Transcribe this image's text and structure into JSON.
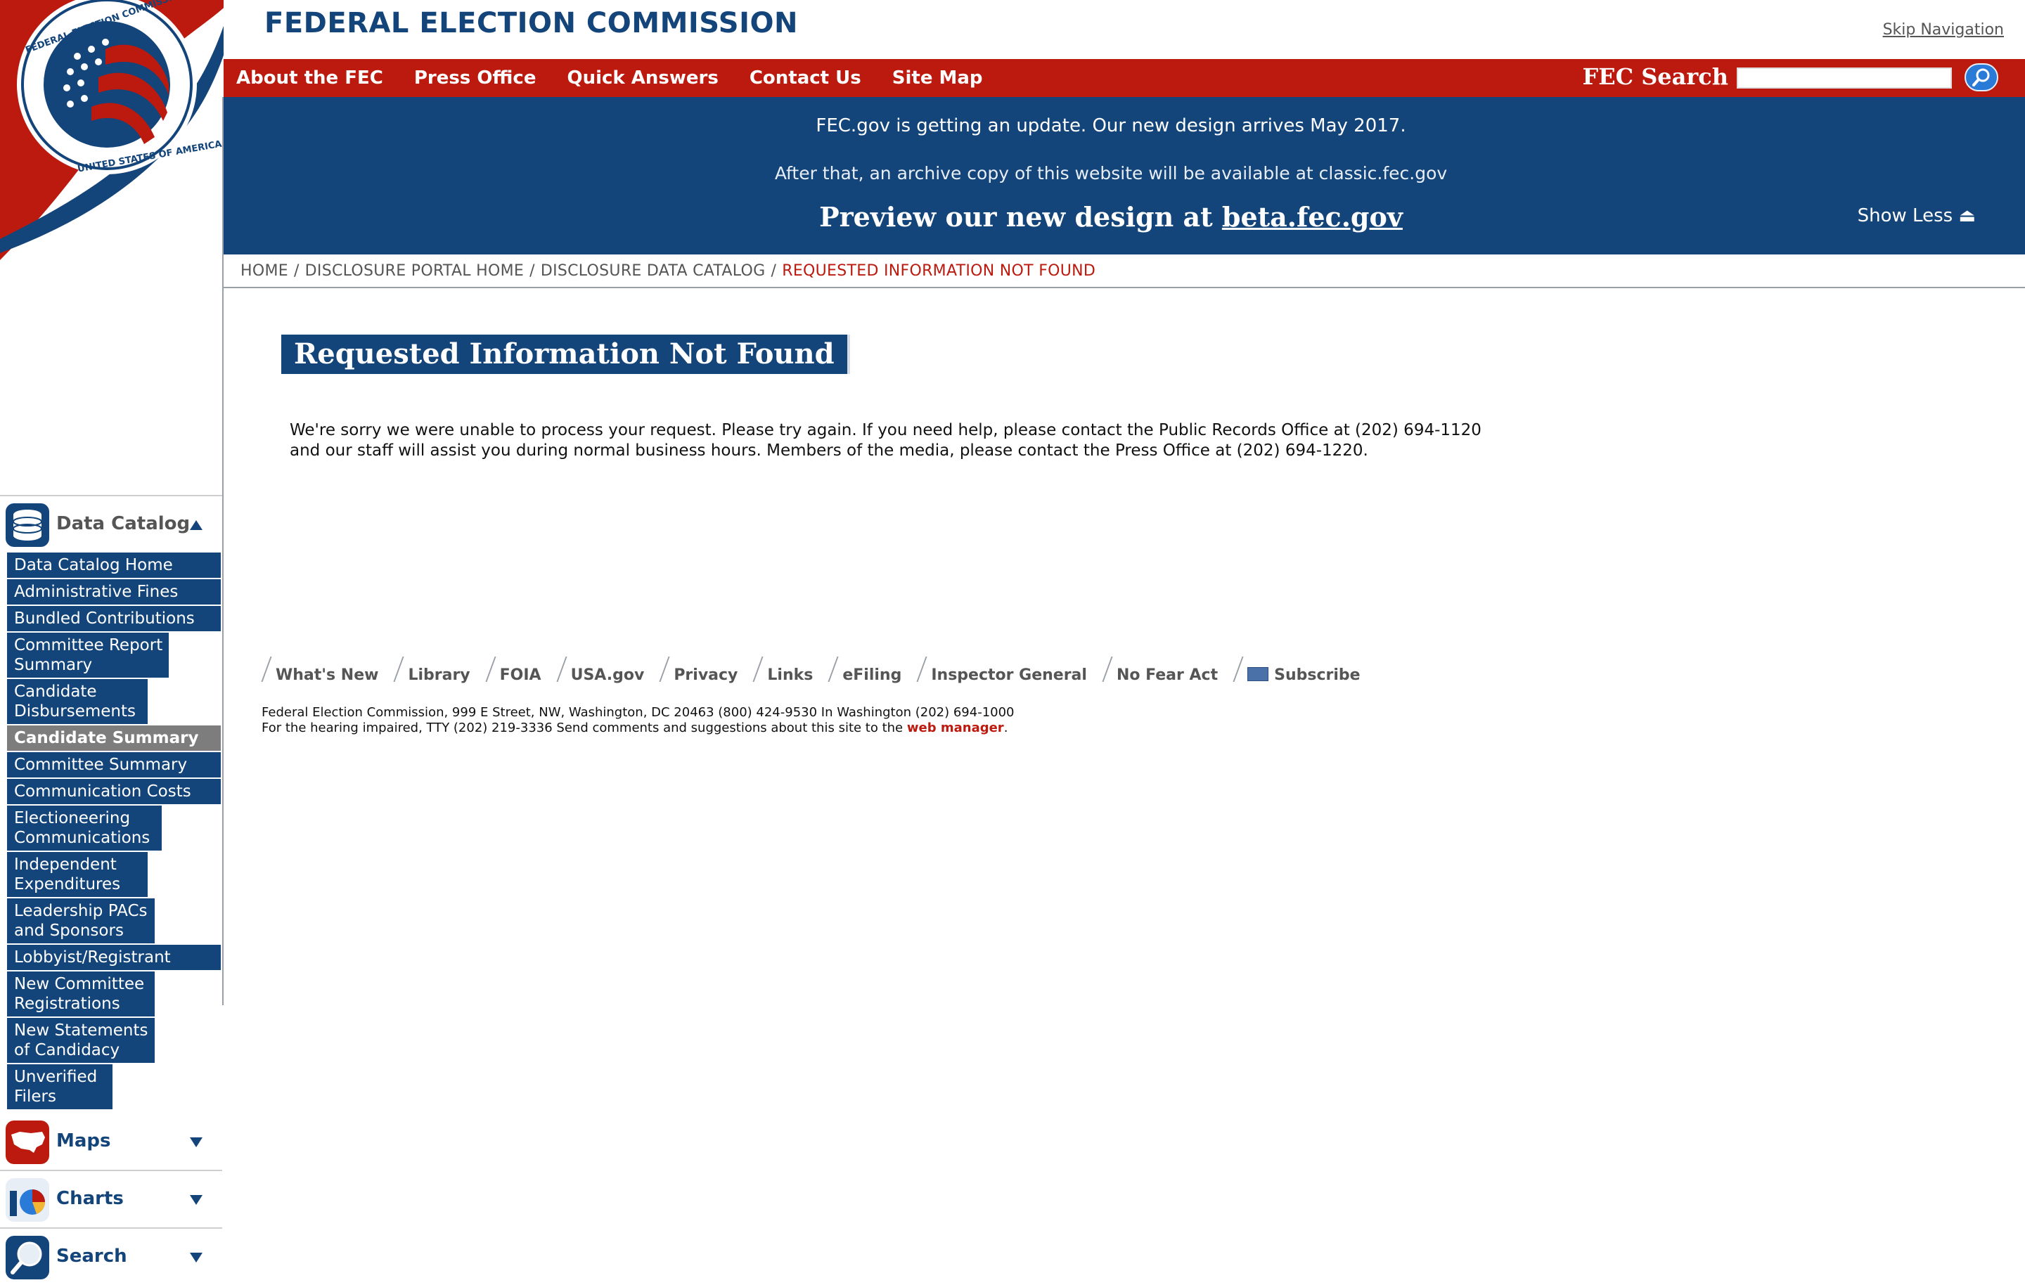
{
  "header": {
    "logo_text": "FEDERAL ELECTION COMMISSION",
    "seal_text": "FEDERAL ELECTION COMMISSION • UNITED STATES OF AMERICA",
    "skip_navigation": "Skip Navigation"
  },
  "topnav": {
    "items": [
      "About the FEC",
      "Press Office",
      "Quick Answers",
      "Contact Us",
      "Site Map"
    ],
    "search_label": "FEC Search",
    "search_placeholder": ""
  },
  "banner": {
    "line1": "FEC.gov is getting an update. Our new design arrives May 2017.",
    "line2": "After that, an archive copy of this website will be available at classic.fec.gov",
    "preview_prefix": "Preview our new design at ",
    "preview_link": "beta.fec.gov",
    "show_less": "Show Less ⏏"
  },
  "breadcrumb": {
    "items": [
      "HOME",
      "DISCLOSURE PORTAL HOME",
      "DISCLOSURE DATA CATALOG"
    ],
    "current": "REQUESTED INFORMATION NOT FOUND",
    "separator": "/"
  },
  "main": {
    "title": "Requested Information Not Found",
    "message_line1": "We're sorry we were unable to process your request. Please try again. If you need help, please contact the Public Records Office at (202) 694-1120",
    "message_line2": "and our staff will assist you during normal business hours. Members of the media, please contact the Press Office at (202) 694-1220."
  },
  "sidebar": {
    "data_catalog": {
      "label": "Data Catalog",
      "items": [
        "Data Catalog Home",
        "Administrative Fines",
        "Bundled Contributions",
        "Committee Report Summary",
        "Candidate Disbursements",
        "Candidate Summary",
        "Committee Summary",
        "Communication Costs",
        "Electioneering Communications",
        "Independent Expenditures",
        "Leadership PACs and Sponsors",
        "Lobbyist/Registrant",
        "New Committee Registrations",
        "New Statements of Candidacy",
        "Unverified Filers"
      ],
      "active": "Candidate Summary"
    },
    "maps_label": "Maps",
    "charts_label": "Charts",
    "search_label": "Search"
  },
  "footer": {
    "links": [
      "What's New",
      "Library",
      "FOIA",
      "USA.gov",
      "Privacy",
      "Links",
      "eFiling",
      "Inspector General",
      "No Fear Act",
      "Subscribe"
    ],
    "address_line1": "Federal Election Commission, 999 E Street, NW, Washington, DC 20463 (800) 424-9530 In Washington (202) 694-1000",
    "address_line2_prefix": "For the hearing impaired, TTY (202) 219-3336 Send comments and suggestions about this site to the ",
    "web_manager": "web manager",
    "address_line2_suffix": "."
  },
  "colors": {
    "brand_blue": "#13447a",
    "brand_red": "#bc1a0e"
  }
}
